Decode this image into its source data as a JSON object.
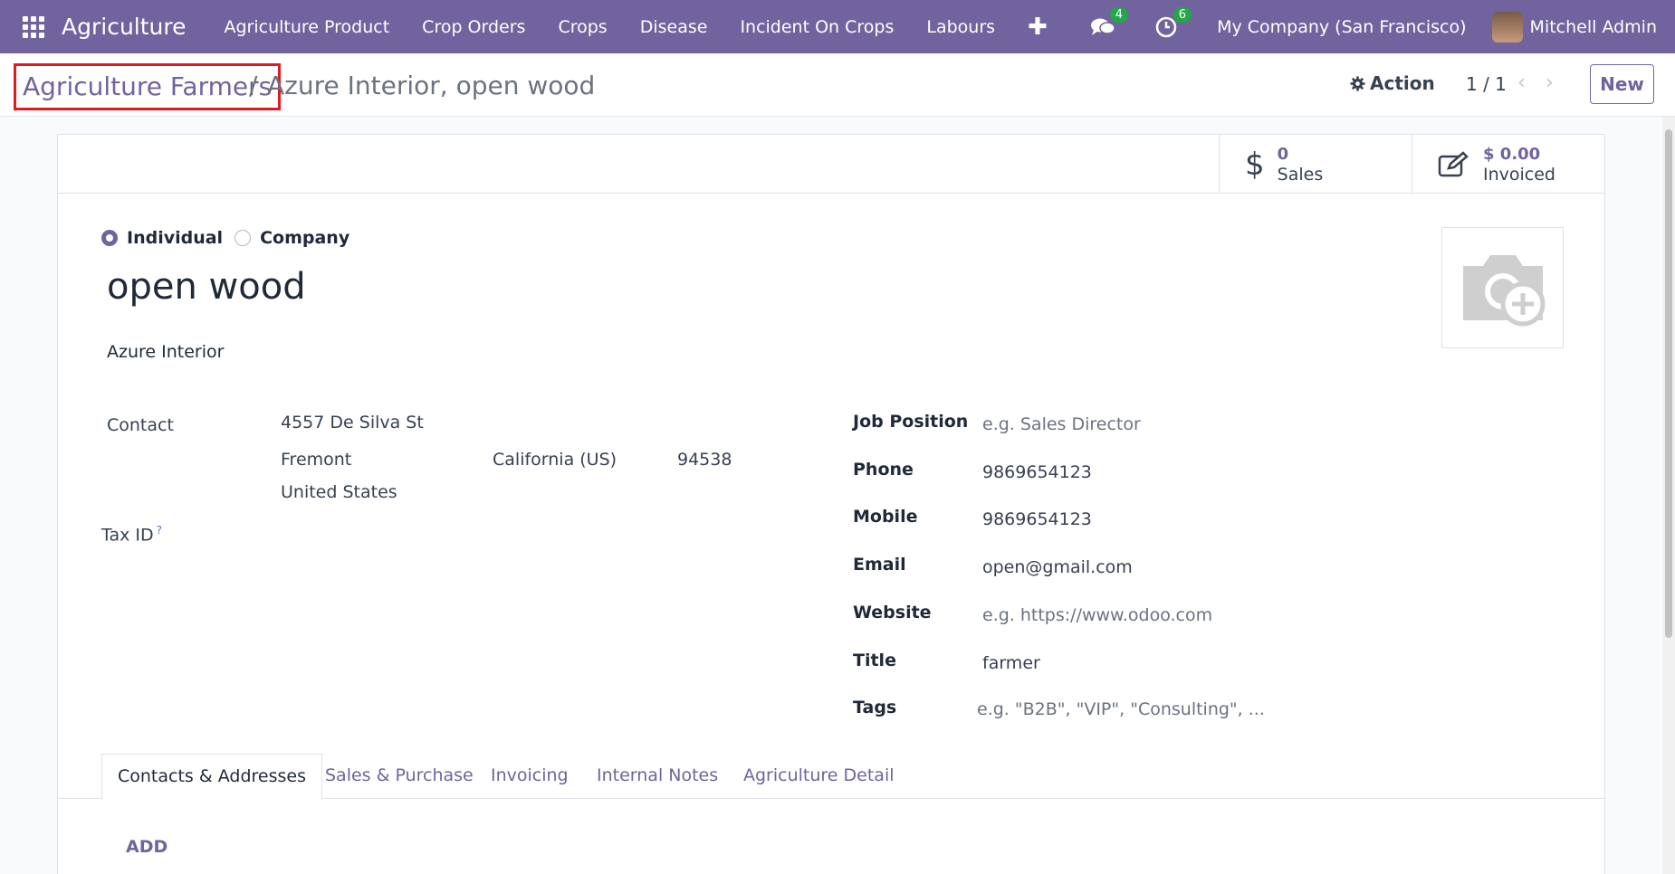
{
  "navbar": {
    "app_name": "Agriculture",
    "menu": [
      "Agriculture Product",
      "Crop Orders",
      "Crops",
      "Disease",
      "Incident On Crops",
      "Labours"
    ],
    "messages_count": "4",
    "activities_count": "6",
    "company": "My Company (San Francisco)",
    "user": "Mitchell Admin",
    "accent_color": "#71639e"
  },
  "control": {
    "breadcrumb_parent": "Agriculture Farmers",
    "breadcrumb_sep": "/",
    "breadcrumb_current": "Azure Interior, open wood",
    "action_label": "Action",
    "pager": "1 / 1",
    "new_label": "New"
  },
  "stats": {
    "sales_value": "0",
    "sales_label": "Sales",
    "invoiced_value": "$ 0.00",
    "invoiced_label": "Invoiced"
  },
  "form": {
    "type_individual": "Individual",
    "type_company": "Company",
    "selected_type": "Individual",
    "name": "open wood",
    "parent_company": "Azure Interior",
    "contact_label": "Contact",
    "street": "4557 De Silva St",
    "city": "Fremont",
    "state": "California (US)",
    "zip": "94538",
    "country": "United States",
    "tax_id_label": "Tax ID",
    "tax_id_help": "?",
    "job_position_label": "Job Position",
    "job_position_placeholder": "e.g. Sales Director",
    "phone_label": "Phone",
    "phone": "9869654123",
    "mobile_label": "Mobile",
    "mobile": "9869654123",
    "email_label": "Email",
    "email": "open@gmail.com",
    "website_label": "Website",
    "website_placeholder": "e.g. https://www.odoo.com",
    "title_label": "Title",
    "title": "farmer",
    "tags_label": "Tags",
    "tags_placeholder": "e.g. \"B2B\", \"VIP\", \"Consulting\", ..."
  },
  "tabs": [
    "Contacts & Addresses",
    "Sales & Purchase",
    "Invoicing",
    "Internal Notes",
    "Agriculture Detail"
  ],
  "active_tab": "Contacts & Addresses",
  "add_label": "ADD"
}
